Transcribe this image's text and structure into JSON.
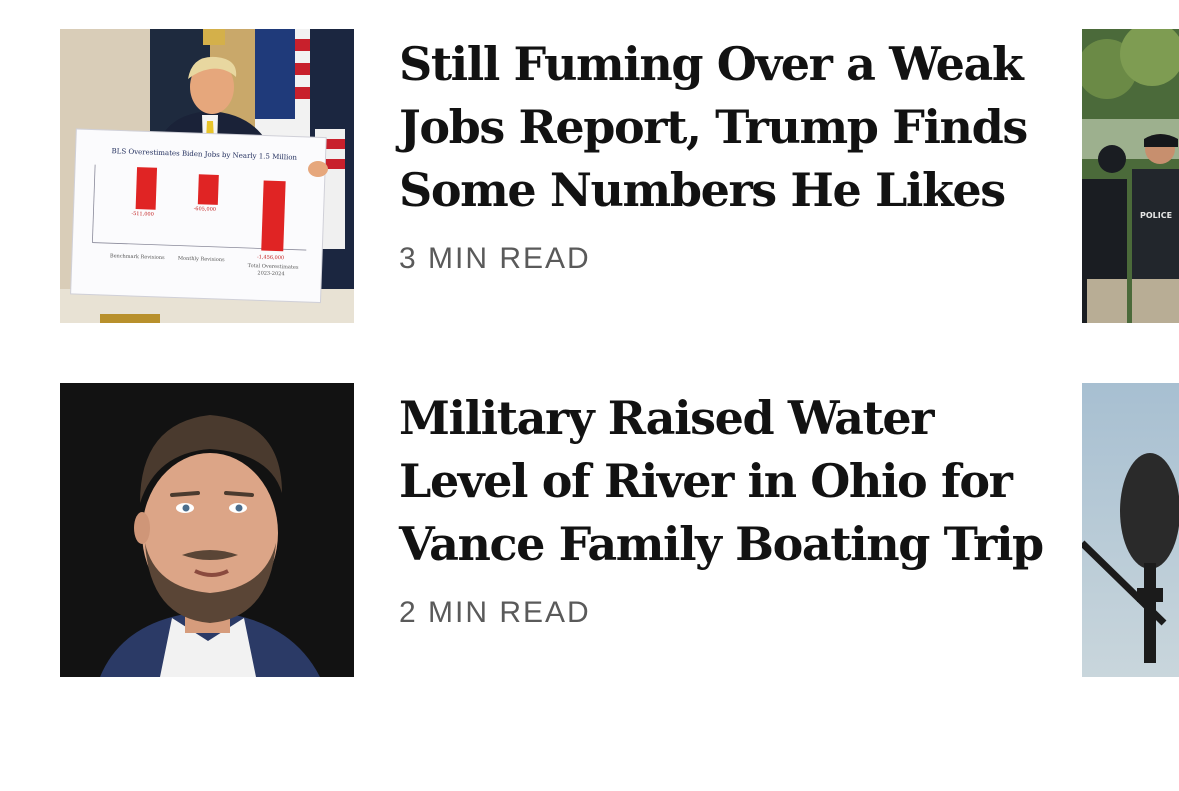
{
  "stories": [
    {
      "headline": "Still Fuming Over a Weak Jobs Report, Trump Finds Some Numbers He Likes",
      "read_time": "3 MIN READ",
      "image": {
        "subject": "person-holding-chart-icon",
        "poster": {
          "title": "BLS Overestimates Biden Jobs by Nearly 1.5 Million",
          "bar_labels": [
            "-511,000",
            "-605,000",
            "-1,456,000"
          ],
          "categories": [
            "Benchmark Revisions",
            "Monthly Revisions",
            "Total Overestimates 2023-2024"
          ],
          "accent": "#e02424"
        }
      }
    },
    {
      "headline": "Military Raised Water Level of River in Ohio for Vance Family Boating Trip",
      "read_time": "2 MIN READ",
      "image": {
        "subject": "portrait-icon"
      }
    }
  ],
  "peek_cards": [
    {
      "subject": "police-officers-icon",
      "vest_label": "POLICE"
    },
    {
      "subject": "microphone-icon"
    }
  ]
}
